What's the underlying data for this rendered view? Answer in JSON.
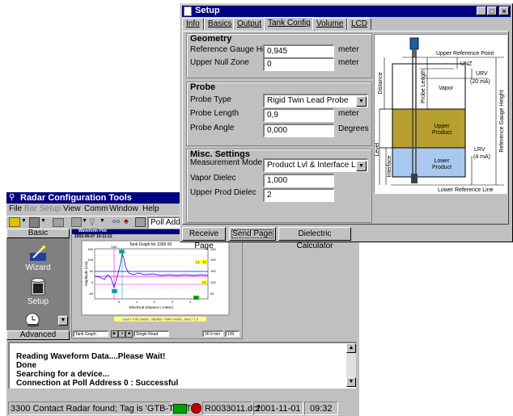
{
  "main_window": {
    "title": "Radar Configuration Tools",
    "menu": [
      "File",
      "Bar",
      "Setup",
      "View",
      "Comm",
      "Window",
      "Help"
    ],
    "poll_address_value": "Poll Addre",
    "sidebar": {
      "top_label": "Basic",
      "items": [
        {
          "label": "Wizard",
          "icon": "wizard-wand-icon"
        },
        {
          "label": "Setup",
          "icon": "setup-cylinder-icon"
        },
        {
          "label": "",
          "icon": "clock-timer-icon"
        }
      ],
      "bottom_label": "Advanced"
    },
    "plot": {
      "window_title": "Waveform Plot",
      "timestamp": "2002-06-07 10:11:12",
      "chart_title": "Tank Graph for 3300 00",
      "ylabel": "Amplitude (Cts)",
      "xlabel": "Electrical Distance ( meter)",
      "y_ticks_left": [
        "150",
        "100",
        "50",
        "0",
        "-50"
      ],
      "y_ticks_right": [
        "250",
        "200",
        "150",
        "100",
        "50"
      ],
      "x_ticks": [
        "0",
        "1",
        "2",
        "3",
        "4"
      ],
      "marker_labels": [
        "UNZ",
        "T1",
        "T2",
        "L1",
        "L2",
        "BL",
        "P1"
      ],
      "status_line": "Level = 0.95 ( meter) , Interface = NAN ( meter) , Dielc = 1.9",
      "bottom_select": "Tank Graph",
      "bottom_select2": "Single Read",
      "bottom_value": "30.0 min",
      "bottom_value2": "100"
    },
    "log": {
      "lines": [
        "Reading Waveform Data....Please Wait!",
        "Done",
        "Searching for a device...",
        "Connection at Poll Address 0 : Successful"
      ]
    },
    "status_bar": {
      "message": "3300 Contact Radar found; Tag is 'GTB-TEST'",
      "file": "R0033011.dcf",
      "date": "2001-11-01",
      "time": "09:32"
    }
  },
  "setup_window": {
    "title": "Setup",
    "tabs": [
      "Info",
      "Basics",
      "Output",
      "Tank Config",
      "Volume",
      "LCD"
    ],
    "active_tab": "Tank Config",
    "geometry": {
      "title": "Geometry",
      "reference_gauge_height_label": "Reference Gauge Height",
      "reference_gauge_height_value": "0,945",
      "reference_gauge_height_unit": "meter",
      "upper_null_zone_label": "Upper Null Zone",
      "upper_null_zone_value": "0",
      "upper_null_zone_unit": "meter"
    },
    "probe": {
      "title": "Probe",
      "type_label": "Probe Type",
      "type_value": "Rigid Twin Lead Probe",
      "length_label": "Probe Length",
      "length_value": "0,9",
      "length_unit": "meter",
      "angle_label": "Probe Angle",
      "angle_value": "0,000",
      "angle_unit": "Degrees"
    },
    "misc": {
      "title": "Misc. Settings",
      "mode_label": "Measurement Mode",
      "mode_value": "Product Lvl & Interface Lvl",
      "vapor_label": "Vapor Dielec",
      "vapor_value": "1,000",
      "upper_label": "Upper Prod Dielec",
      "upper_value": "2"
    },
    "diagram": {
      "upper_reference_point": "Upper Reference Point",
      "unz": "UNZ",
      "urv": "URV",
      "urv_ma": "(20 mA)",
      "distance": "Distance",
      "probe_length": "Probe Length",
      "vapor": "Vapor",
      "reference_gauge_height": "Reference Gauge Height",
      "upper_product_1": "Upper",
      "upper_product_2": "Product",
      "level": "Level",
      "interface": "Interface",
      "lrv": "LRV",
      "lrv_ma": "(4 mA)",
      "lower_product_1": "Lower",
      "lower_product_2": "Product",
      "lower_reference_line": "Lower Reference Line"
    },
    "buttons": {
      "receive": "Receive Page",
      "send": "Send Page",
      "dielectric": "Dielectric Calculator"
    }
  }
}
